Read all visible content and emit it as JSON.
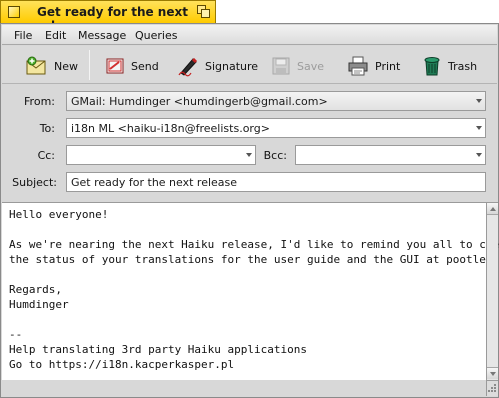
{
  "window": {
    "title": "Get ready for the next release"
  },
  "menu": [
    "File",
    "Edit",
    "Message",
    "Queries"
  ],
  "toolbar": {
    "new": "New",
    "send": "Send",
    "signature": "Signature",
    "save": "Save",
    "print": "Print",
    "trash": "Trash"
  },
  "fields": {
    "from_label": "From:",
    "from_value": "GMail:  Humdinger <humdingerb@gmail.com>",
    "to_label": "To:",
    "to_value": "i18n ML <haiku-i18n@freelists.org>",
    "cc_label": "Cc:",
    "cc_value": "",
    "bcc_label": "Bcc:",
    "bcc_value": "",
    "subject_label": "Subject:",
    "subject_value": "Get ready for the next release"
  },
  "body": "Hello everyone!\n\nAs we're nearing the next Haiku release, I'd like to remind you all to check\nthe status of your translations for the user guide and the GUI at pootle.\n\nRegards,\nHumdinger\n\n--\nHelp translating 3rd party Haiku applications\nGo to https://i18n.kacperkasper.pl",
  "colors": {
    "tab": "#ffcb00",
    "panel": "#d8d8d8"
  }
}
